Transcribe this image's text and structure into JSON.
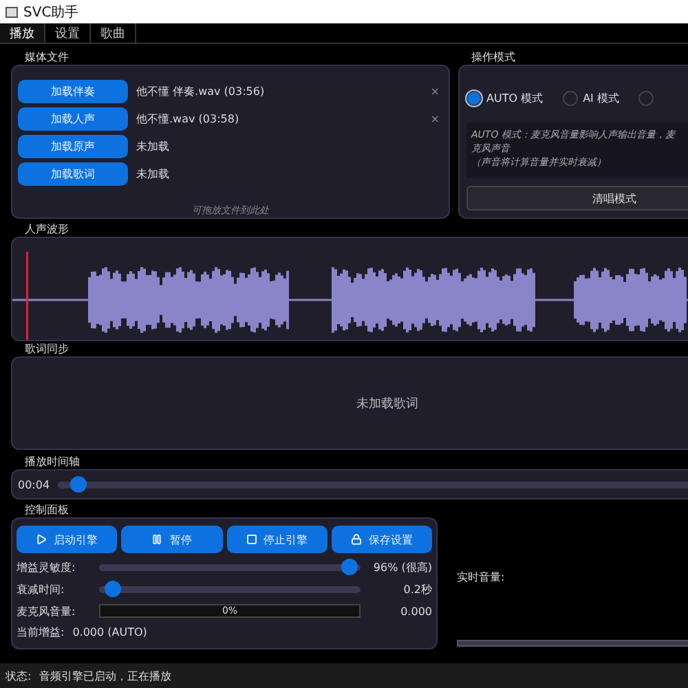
{
  "window": {
    "title": "SVC助手"
  },
  "menu": [
    {
      "label": "播放",
      "selected": true
    },
    {
      "label": "设置",
      "selected": false
    },
    {
      "label": "歌曲",
      "selected": false
    }
  ],
  "media": {
    "title": "媒体文件",
    "hint": "可拖放文件到此处",
    "files": [
      {
        "button": "加载伴奏",
        "file": "他不懂 伴奏.wav (03:56)",
        "removable": true
      },
      {
        "button": "加载人声",
        "file": "他不懂.wav (03:58)",
        "removable": true
      },
      {
        "button": "加载原声",
        "file": "未加载",
        "removable": false
      },
      {
        "button": "加载歌词",
        "file": "未加载",
        "removable": false
      }
    ],
    "remove_glyph": "×"
  },
  "mode": {
    "title": "操作模式",
    "options": [
      {
        "label": "AUTO 模式",
        "selected": true
      },
      {
        "label": "AI 模式",
        "selected": false
      },
      {
        "selected": false
      }
    ],
    "description": [
      "AUTO 模式：麦克风音量影响人声输出音量，麦",
      "克风声音",
      "（声音将计算音量并实时衰减）"
    ],
    "button": "清唱模式"
  },
  "waveform": {
    "title": "人声波形"
  },
  "lyrics": {
    "title": "歌词同步",
    "message": "未加载歌词"
  },
  "timeline": {
    "title": "播放时间轴",
    "time": "00:04",
    "level": 0.03
  },
  "control": {
    "title": "控制面板",
    "buttons": [
      {
        "kind": "play",
        "label": "启动引擎"
      },
      {
        "kind": "pause",
        "label": "暂停"
      },
      {
        "kind": "stop",
        "label": "停止引擎"
      },
      {
        "kind": "save",
        "label": "保存设置"
      }
    ],
    "sliders": [
      {
        "label": "增益灵敏度:",
        "level": 0.96,
        "reading": "96% (很高)"
      },
      {
        "label": "衰减时间:",
        "level": 0.05,
        "reading": "0.2秒"
      }
    ],
    "meter": {
      "label": "麦克风音量:",
      "level": 0,
      "text": "0%",
      "reading": "0.000"
    },
    "gain": {
      "label": "当前增益:",
      "value": "0.000 (AUTO)"
    }
  },
  "realtime": {
    "label": "实时音量:"
  },
  "status": {
    "label": "状态:",
    "text": "音频引擎已启动，正在播放"
  }
}
